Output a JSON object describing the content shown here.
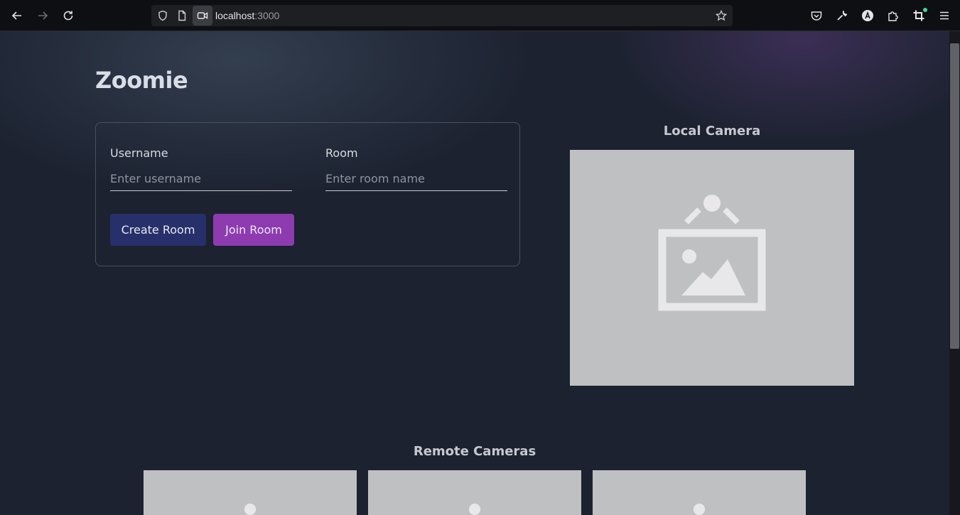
{
  "browser": {
    "url_host": "localhost",
    "url_port": ":3000"
  },
  "app": {
    "title": "Zoomie"
  },
  "form": {
    "username_label": "Username",
    "username_placeholder": "Enter username",
    "room_label": "Room",
    "room_placeholder": "Enter room name",
    "create_button": "Create Room",
    "join_button": "Join Room"
  },
  "local_camera": {
    "title": "Local Camera"
  },
  "remote_cameras": {
    "title": "Remote Cameras",
    "count": 3
  },
  "colors": {
    "page_bg": "#1c2230",
    "create_button": "#27306a",
    "join_button": "#8e3bb0",
    "camera_placeholder": "#bfc0c2"
  }
}
